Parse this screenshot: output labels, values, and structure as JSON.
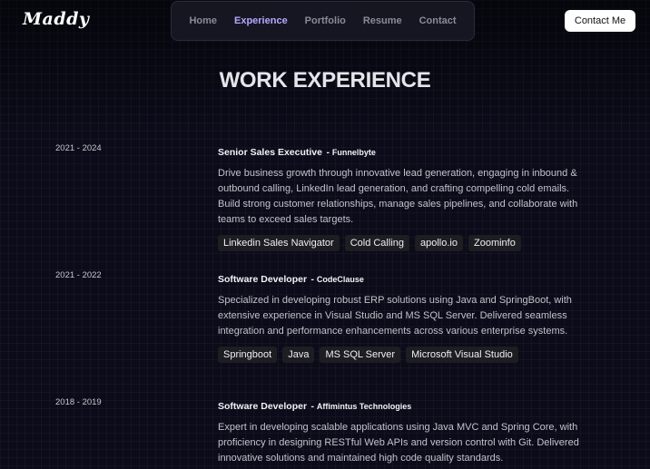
{
  "logo": "Maddy",
  "nav": [
    "Home",
    "Experience",
    "Portfolio",
    "Resume",
    "Contact"
  ],
  "contact_button": "Contact Me",
  "title": "WORK EXPERIENCE",
  "experience": [
    {
      "date": "2021 - 2024",
      "role": "Senior Sales Executive",
      "company": "Funnelbyte",
      "description": "Drive business growth through innovative lead generation, engaging in inbound & outbound calling, LinkedIn lead generation, and crafting compelling cold emails. Build strong customer relationships, manage sales pipelines, and collaborate with teams to exceed sales targets.",
      "tags": [
        "Linkedin Sales Navigator",
        "Cold Calling",
        "apollo.io",
        "Zoominfo"
      ]
    },
    {
      "date": "2021 - 2022",
      "role": "Software Developer",
      "company": "CodeClause",
      "description": "Specialized in developing robust ERP solutions using Java and SpringBoot, with extensive experience in Visual Studio and MS SQL Server. Delivered seamless integration and performance enhancements across various enterprise systems.",
      "tags": [
        "Springboot",
        "Java",
        "MS SQL Server",
        "Microsoft Visual Studio"
      ]
    },
    {
      "date": "2018 - 2019",
      "role": "Software Developer",
      "company": "Affimintus Technologies",
      "description": "Expert in developing scalable applications using Java MVC and Spring Core, with proficiency in designing RESTful Web APIs and version control with Git. Delivered innovative solutions and maintained high code quality standards.",
      "tags": []
    }
  ]
}
